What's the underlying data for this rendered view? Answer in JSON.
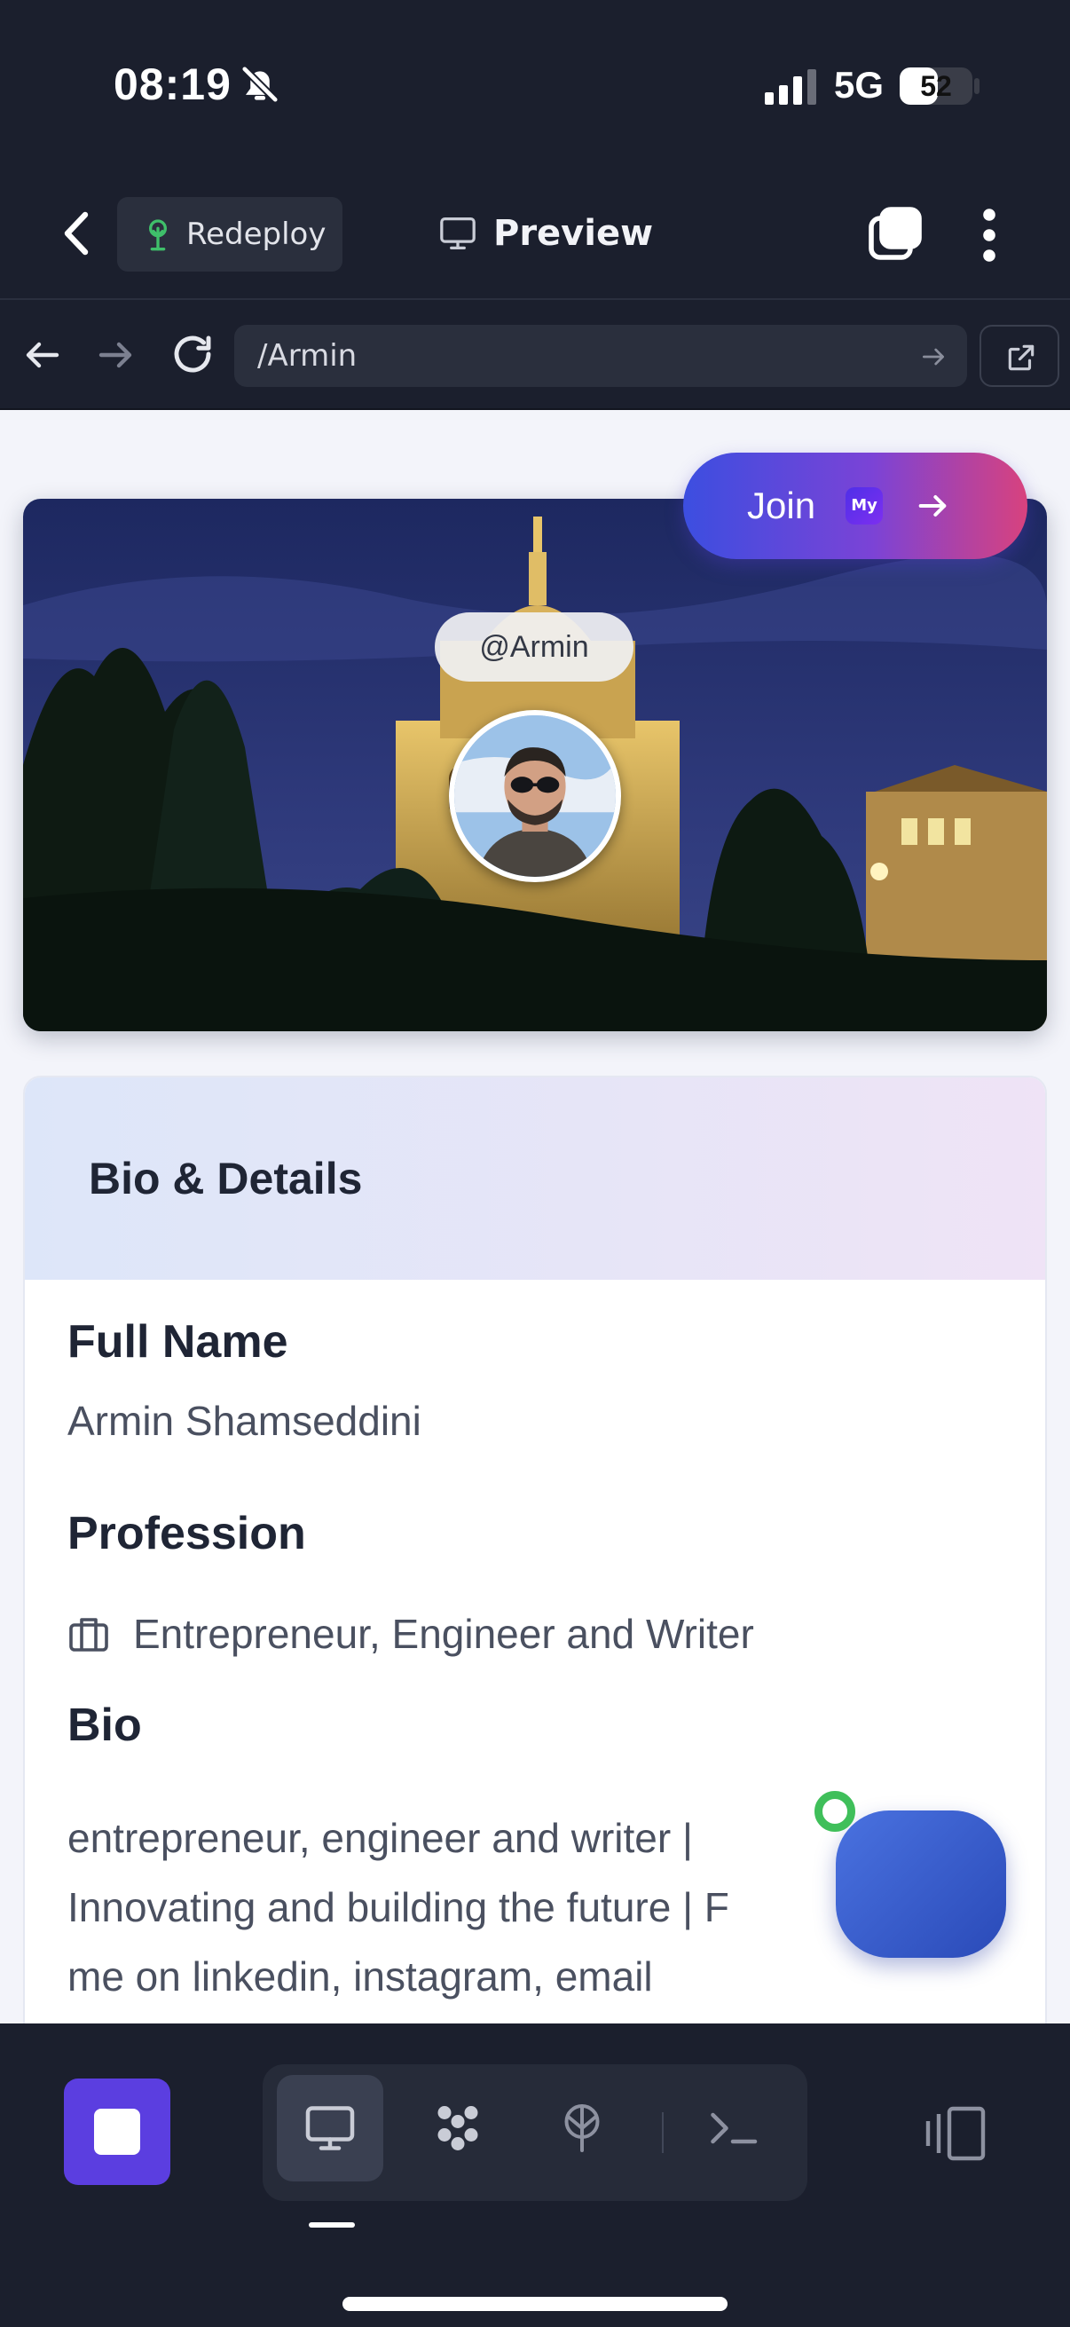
{
  "status_bar": {
    "time": "08:19",
    "network": "5G",
    "battery": "52",
    "battery_level": 0.52,
    "icons": [
      "bell-slash-icon",
      "signal-bars-icon"
    ]
  },
  "app_bar": {
    "redeploy_label": "Redeploy",
    "preview_label": "Preview",
    "icons": [
      "chevron-left-icon",
      "tree-icon",
      "monitor-icon",
      "tabs-icon",
      "more-vertical-icon"
    ]
  },
  "browser_bar": {
    "url": "/Armin",
    "icons": [
      "arrow-left-icon",
      "arrow-right-icon",
      "reload-icon",
      "arrow-go-icon",
      "external-link-icon"
    ]
  },
  "profile": {
    "join_label": "Join",
    "join_badge": "My",
    "handle": "@Armin"
  },
  "bio_card": {
    "title": "Bio & Details",
    "full_name_label": "Full Name",
    "full_name_value": "Armin Shamseddini",
    "profession_label": "Profession",
    "profession_value": "Entrepreneur, Engineer and Writer",
    "bio_label": "Bio",
    "bio_lines": [
      "entrepreneur, engineer and writer |",
      "Innovating and building the future | F",
      "me on linkedin, instagram, email"
    ]
  },
  "dock": {
    "icons": [
      "app-square-icon",
      "monitor-icon",
      "nodes-icon",
      "tree-icon",
      "terminal-icon",
      "split-view-icon"
    ]
  },
  "colors": {
    "dark_bg": "#1b1f2d",
    "accent_purple": "#5b3ee0",
    "join_gradient_start": "#3c4ee0",
    "join_gradient_end": "#d8427e",
    "status_green": "#3fbf5a"
  }
}
